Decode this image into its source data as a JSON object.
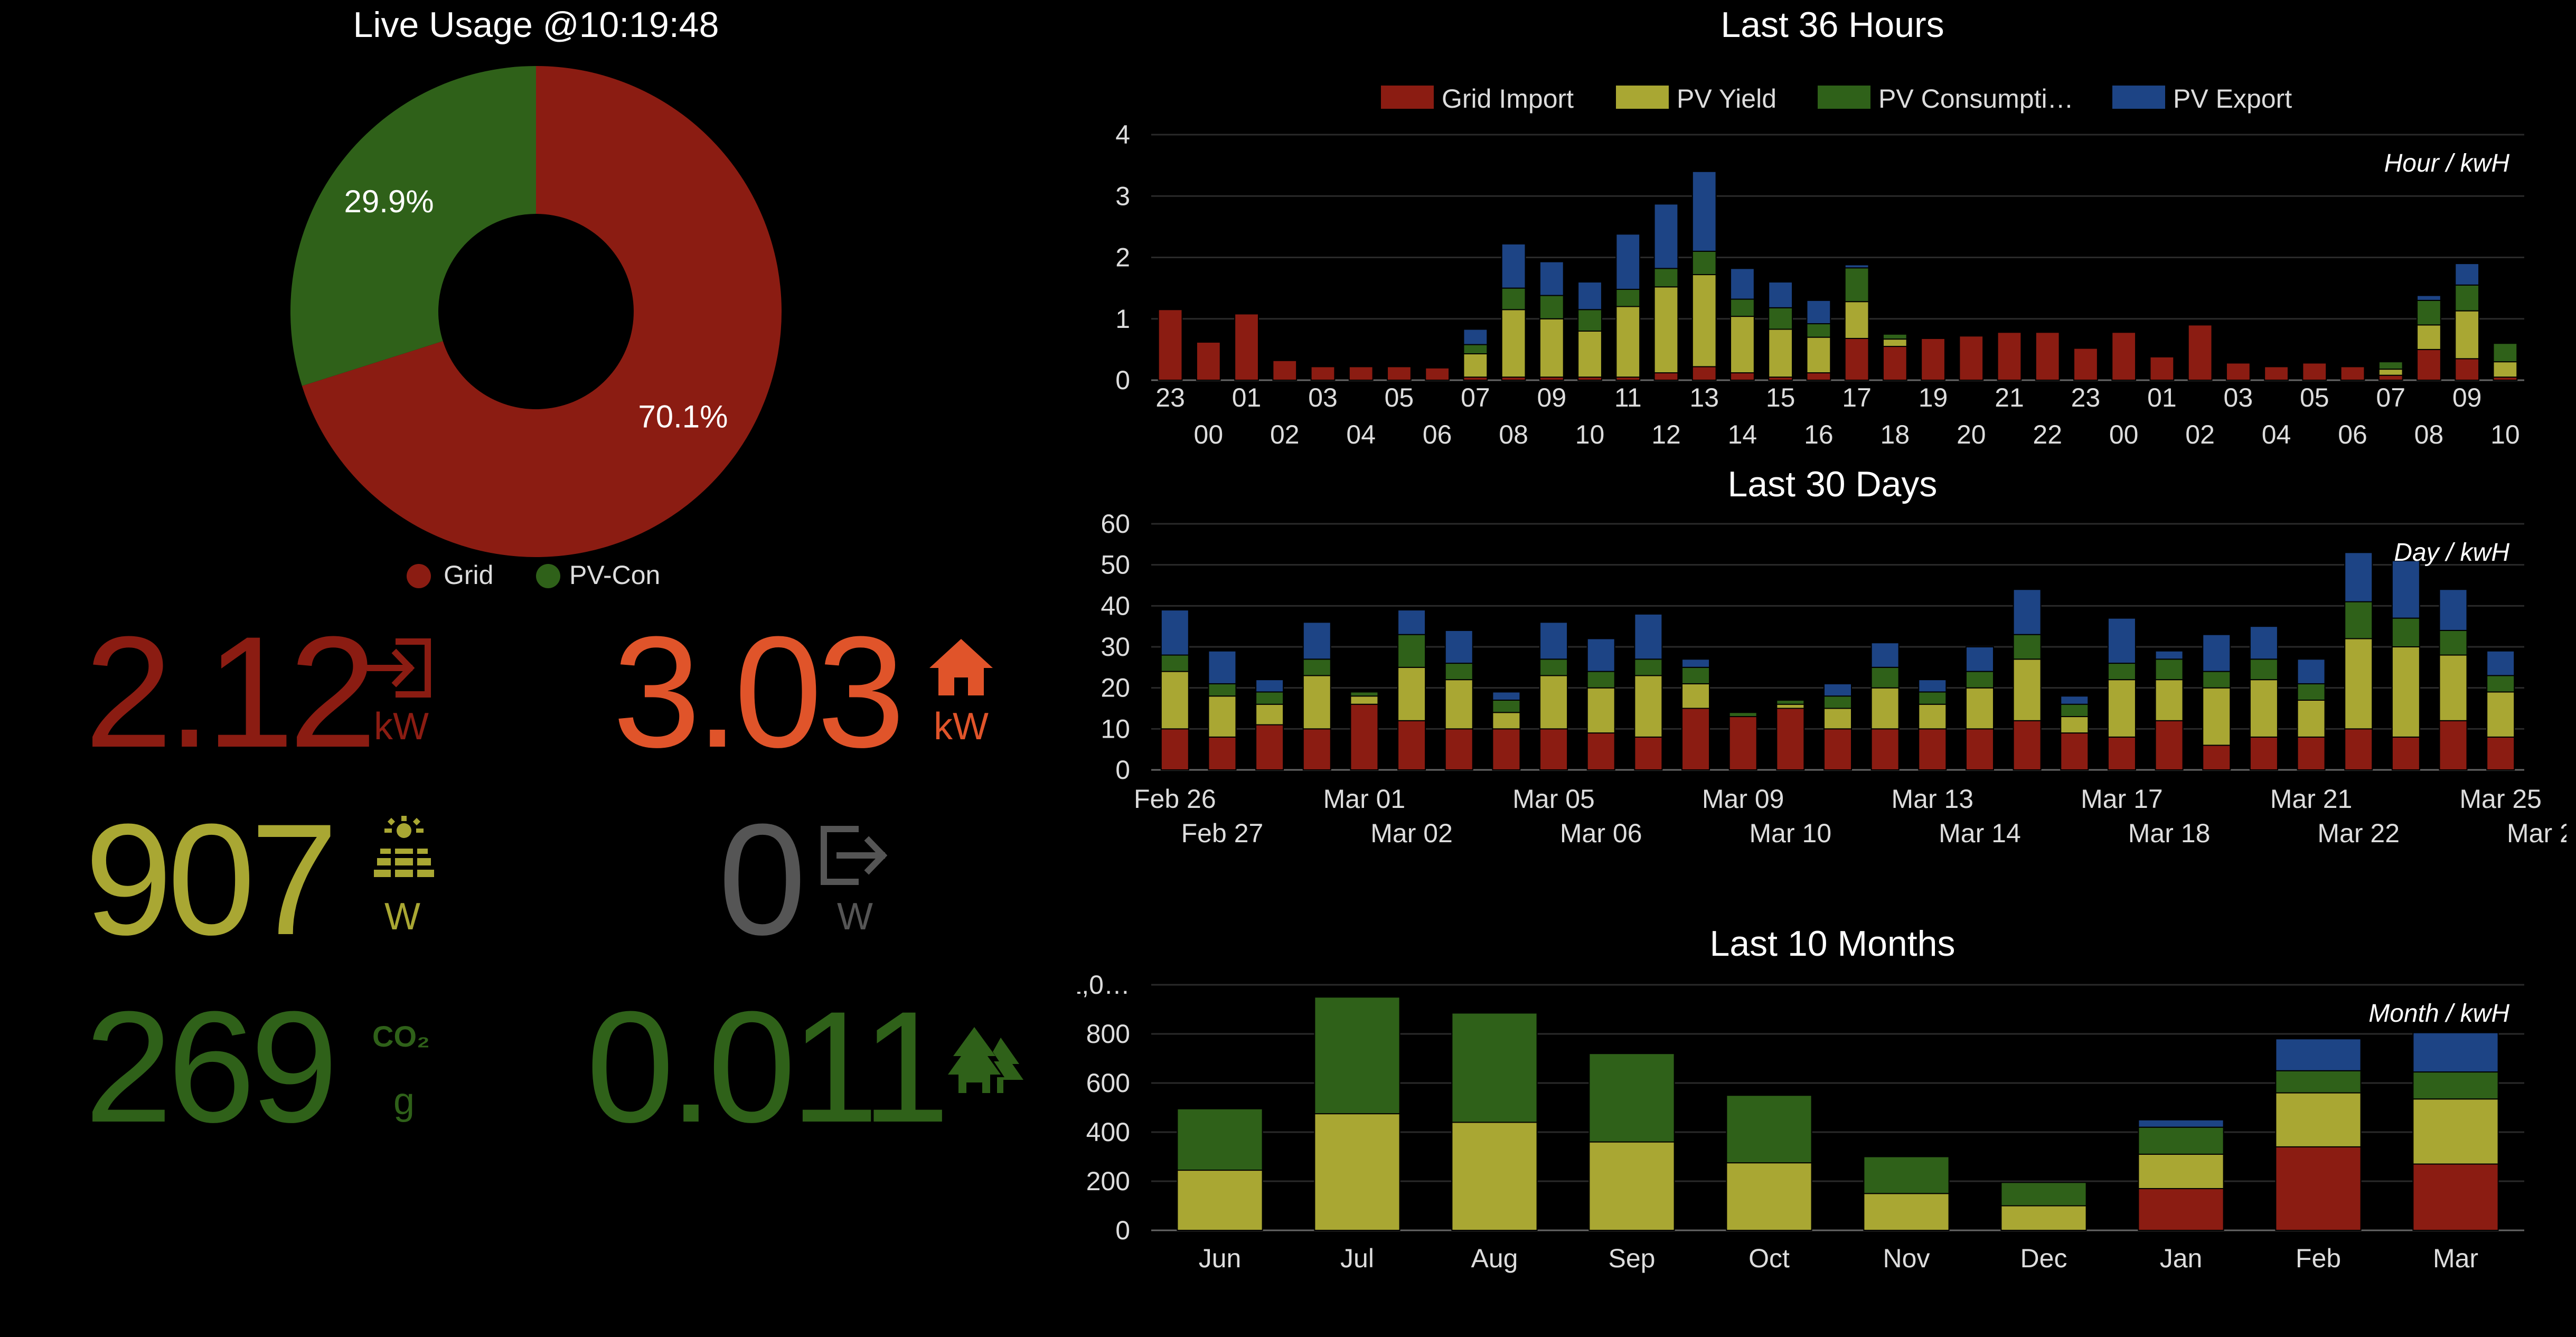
{
  "live": {
    "title": "Live Usage @10:19:48",
    "slices": [
      {
        "label": "Grid",
        "percent": 70.1,
        "percent_text": "70.1%",
        "color": "#8b1c12"
      },
      {
        "label": "PV-Con",
        "percent": 29.9,
        "percent_text": "29.9%",
        "color": "#2f6119"
      }
    ]
  },
  "stats": {
    "grid_import": {
      "value": "2.12",
      "unit": "kW",
      "color": "#8b1c12",
      "icon": "login-icon"
    },
    "house_load": {
      "value": "3.03",
      "unit": "kW",
      "color": "#e0542a",
      "icon": "home-icon"
    },
    "pv_yield": {
      "value": "907",
      "unit": "W",
      "color": "#a9a733",
      "icon": "solar-panel-icon"
    },
    "pv_export": {
      "value": "0",
      "unit": "W",
      "color": "#555555",
      "icon": "logout-icon"
    },
    "co2": {
      "value": "269",
      "unit": "g",
      "unit_top": "CO₂",
      "color": "#2f6119",
      "icon": "co2-icon"
    },
    "trees": {
      "value": "0.011",
      "color": "#2f6119",
      "icon": "trees-icon"
    }
  },
  "legend": [
    {
      "label": "Grid Import",
      "color": "#8b1c12"
    },
    {
      "label": "PV Yield",
      "color": "#a9a733"
    },
    {
      "label": "PV Consumpti…",
      "color": "#2f6119"
    },
    {
      "label": "PV Export",
      "color": "#1d4485"
    }
  ],
  "chart_data": [
    {
      "type": "bar",
      "title": "Last 36 Hours",
      "annotation": "Hour / kwH",
      "stacked": true,
      "ylim": [
        0,
        4
      ],
      "yticks": [
        "0",
        "1",
        "2",
        "3",
        "4"
      ],
      "categories": [
        "23",
        "00",
        "01",
        "02",
        "03",
        "04",
        "05",
        "06",
        "07",
        "08",
        "09",
        "10",
        "11",
        "12",
        "13",
        "14",
        "15",
        "16",
        "17",
        "18",
        "19",
        "20",
        "21",
        "22",
        "23",
        "00",
        "01",
        "02",
        "03",
        "04",
        "05",
        "06",
        "07",
        "08",
        "09",
        "10"
      ],
      "series": [
        {
          "name": "Grid Import",
          "color": "#8b1c12",
          "values": [
            1.15,
            0.62,
            1.08,
            0.32,
            0.22,
            0.22,
            0.22,
            0.2,
            0.05,
            0.05,
            0.05,
            0.05,
            0.05,
            0.12,
            0.22,
            0.12,
            0.05,
            0.12,
            0.68,
            0.55,
            0.68,
            0.72,
            0.78,
            0.78,
            0.52,
            0.78,
            0.38,
            0.9,
            0.28,
            0.22,
            0.28,
            0.22,
            0.08,
            0.5,
            0.35,
            0.05
          ]
        },
        {
          "name": "PV Yield",
          "color": "#a9a733",
          "values": [
            0,
            0,
            0,
            0,
            0,
            0,
            0,
            0,
            0.38,
            1.1,
            0.95,
            0.75,
            1.15,
            1.4,
            1.5,
            0.92,
            0.78,
            0.58,
            0.6,
            0.12,
            0,
            0,
            0,
            0,
            0,
            0,
            0,
            0,
            0,
            0,
            0,
            0,
            0.1,
            0.4,
            0.78,
            0.25
          ]
        },
        {
          "name": "PV Consumpti…",
          "color": "#2f6119",
          "values": [
            0,
            0,
            0,
            0,
            0,
            0,
            0,
            0,
            0.15,
            0.35,
            0.38,
            0.35,
            0.28,
            0.3,
            0.38,
            0.28,
            0.35,
            0.22,
            0.55,
            0.08,
            0,
            0,
            0,
            0,
            0,
            0,
            0,
            0,
            0,
            0,
            0,
            0,
            0.12,
            0.4,
            0.42,
            0.3
          ]
        },
        {
          "name": "PV Export",
          "color": "#1d4485",
          "values": [
            0,
            0,
            0,
            0,
            0,
            0,
            0,
            0,
            0.25,
            0.72,
            0.55,
            0.45,
            0.9,
            1.05,
            1.3,
            0.5,
            0.42,
            0.38,
            0.05,
            0,
            0,
            0,
            0,
            0,
            0,
            0,
            0,
            0,
            0,
            0,
            0,
            0,
            0,
            0.08,
            0.35,
            0
          ]
        }
      ]
    },
    {
      "type": "bar",
      "title": "Last 30 Days",
      "annotation": "Day / kwH",
      "stacked": true,
      "ylim": [
        0,
        60
      ],
      "yticks": [
        "0",
        "10",
        "20",
        "30",
        "40",
        "50",
        "60"
      ],
      "categories": [
        "Feb 26",
        "Feb 27",
        "Feb 28",
        "Mar 01",
        "Mar 02",
        "Mar 03",
        "Mar 04",
        "Mar 05",
        "Mar 06",
        "Mar 07",
        "Mar 08",
        "Mar 09",
        "Mar 10",
        "Mar 11",
        "Mar 12",
        "Mar 13",
        "Mar 14",
        "Mar 15",
        "Mar 16",
        "Mar 17",
        "Mar 18",
        "Mar 19",
        "Mar 20",
        "Mar 21",
        "Mar 22",
        "Mar 23",
        "Mar 24",
        "Mar 25",
        "Mar 26"
      ],
      "tick_labels_top": [
        "Feb 26",
        "Mar 01",
        "Mar 05",
        "Mar 09",
        "Mar 13",
        "Mar 17",
        "Mar 21",
        "Mar 25"
      ],
      "tick_labels_bottom": [
        "Feb 27",
        "Mar 02",
        "Mar 06",
        "Mar 10",
        "Mar 14",
        "Mar 18",
        "Mar 22",
        "Mar 26"
      ],
      "series": [
        {
          "name": "Grid Import",
          "color": "#8b1c12",
          "values": [
            10,
            8,
            11,
            10,
            16,
            12,
            10,
            10,
            10,
            9,
            8,
            15,
            13,
            15,
            10,
            10,
            10,
            10,
            12,
            9,
            8,
            12,
            6,
            8,
            8,
            10,
            8,
            12,
            8,
            4
          ]
        },
        {
          "name": "PV Yield",
          "color": "#a9a733",
          "values": [
            14,
            10,
            5,
            13,
            2,
            13,
            12,
            4,
            13,
            11,
            15,
            6,
            0,
            1,
            5,
            10,
            6,
            10,
            15,
            4,
            14,
            10,
            14,
            14,
            9,
            22,
            22,
            16,
            11,
            1
          ]
        },
        {
          "name": "PV Consumpti…",
          "color": "#2f6119",
          "values": [
            4,
            3,
            3,
            4,
            1,
            8,
            4,
            3,
            4,
            4,
            4,
            4,
            1,
            1,
            3,
            5,
            3,
            4,
            6,
            3,
            4,
            5,
            4,
            5,
            4,
            9,
            7,
            6,
            4,
            1
          ]
        },
        {
          "name": "PV Export",
          "color": "#1d4485",
          "values": [
            11,
            8,
            3,
            9,
            0,
            6,
            8,
            2,
            9,
            8,
            11,
            2,
            0,
            0,
            3,
            6,
            3,
            6,
            11,
            2,
            11,
            2,
            9,
            8,
            6,
            12,
            14,
            10,
            6,
            0
          ]
        }
      ]
    },
    {
      "type": "bar",
      "title": "Last 10 Months",
      "annotation": "Month / kwH",
      "stacked": true,
      "ylim": [
        0,
        1000
      ],
      "yticks": [
        "0",
        "200",
        "400",
        "600",
        "800",
        "1,0…"
      ],
      "categories": [
        "Jun",
        "Jul",
        "Aug",
        "Sep",
        "Oct",
        "Nov",
        "Dec",
        "Jan",
        "Feb",
        "Mar"
      ],
      "series": [
        {
          "name": "Grid Import",
          "color": "#8b1c12",
          "values": [
            0,
            0,
            0,
            0,
            0,
            0,
            0,
            170,
            340,
            270
          ]
        },
        {
          "name": "PV Yield",
          "color": "#a9a733",
          "values": [
            245,
            475,
            440,
            360,
            275,
            150,
            100,
            140,
            220,
            265
          ]
        },
        {
          "name": "PV Consumpti…",
          "color": "#2f6119",
          "values": [
            250,
            475,
            445,
            360,
            275,
            150,
            95,
            110,
            90,
            110
          ]
        },
        {
          "name": "PV Export",
          "color": "#1d4485",
          "values": [
            0,
            0,
            0,
            0,
            0,
            0,
            0,
            30,
            130,
            160
          ]
        }
      ]
    }
  ]
}
